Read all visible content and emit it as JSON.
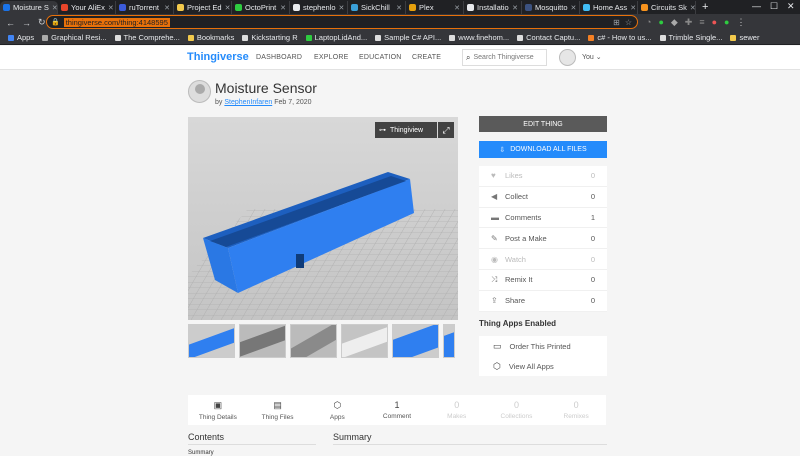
{
  "browser": {
    "tabs": [
      {
        "label": "Moisture S",
        "color": "#1a73e8",
        "active": true
      },
      {
        "label": "Your AliEx",
        "color": "#e8452a"
      },
      {
        "label": "ruTorrent",
        "color": "#3b5bdb"
      },
      {
        "label": "Project Ed",
        "color": "#f2c94c"
      },
      {
        "label": "OctoPrint",
        "color": "#2ecc40"
      },
      {
        "label": "stephenlo",
        "color": "#e8eaed"
      },
      {
        "label": "SickChill",
        "color": "#3aa0d8"
      },
      {
        "label": "Plex",
        "color": "#e5a00d"
      },
      {
        "label": "Installatio",
        "color": "#e8eaed"
      },
      {
        "label": "Mosquitto",
        "color": "#3c5280"
      },
      {
        "label": "Home Ass",
        "color": "#41bdf5"
      },
      {
        "label": "Circuits Sk",
        "color": "#f7931e"
      }
    ],
    "url": "thingiverse.com/thing:4148595",
    "bookmarks": [
      {
        "label": "Apps",
        "color": "#4285f4"
      },
      {
        "label": "Graphical Resi...",
        "color": "#aaaaaa"
      },
      {
        "label": "The Comprehe...",
        "color": "#dddddd"
      },
      {
        "label": "Bookmarks",
        "color": "#f2c94c"
      },
      {
        "label": "Kickstarting R",
        "color": "#dddddd"
      },
      {
        "label": "LaptopLidAnd...",
        "color": "#2ecc40"
      },
      {
        "label": "Sample C# API...",
        "color": "#dddddd"
      },
      {
        "label": "www.finehom...",
        "color": "#dddddd"
      },
      {
        "label": "Contact Captu...",
        "color": "#dddddd"
      },
      {
        "label": "c# - How to us...",
        "color": "#f48024"
      },
      {
        "label": "Trimble Single...",
        "color": "#dddddd"
      },
      {
        "label": "sewer",
        "color": "#f2c94c"
      }
    ]
  },
  "site": {
    "logo": "Thingiverse",
    "nav": [
      "DASHBOARD",
      "EXPLORE",
      "EDUCATION",
      "CREATE"
    ],
    "search_placeholder": "Search Thingiverse",
    "user_label": "You"
  },
  "thing": {
    "title": "Moisture Sensor",
    "by": "by",
    "author": "StephenInfaren",
    "date": "Feb 7, 2020",
    "viewer_button": "Thingiview",
    "thumbnail_count": 6
  },
  "actions": {
    "edit": "EDIT THING",
    "download": "DOWNLOAD ALL FILES"
  },
  "stats": [
    {
      "label": "Likes",
      "count": "0",
      "icon": "heart-icon",
      "glyph": "♥",
      "dim": true
    },
    {
      "label": "Collect",
      "count": "0",
      "icon": "collect-icon",
      "glyph": "◀",
      "dim": false
    },
    {
      "label": "Comments",
      "count": "1",
      "icon": "comment-icon",
      "glyph": "▬",
      "dim": false
    },
    {
      "label": "Post a Make",
      "count": "0",
      "icon": "make-icon",
      "glyph": "✎",
      "dim": false
    },
    {
      "label": "Watch",
      "count": "0",
      "icon": "watch-icon",
      "glyph": "◉",
      "dim": true
    },
    {
      "label": "Remix It",
      "count": "0",
      "icon": "remix-icon",
      "glyph": "⤨",
      "dim": false
    },
    {
      "label": "Share",
      "count": "0",
      "icon": "share-icon",
      "glyph": "⇪",
      "dim": false
    }
  ],
  "thing_apps": {
    "title": "Thing Apps Enabled",
    "items": [
      {
        "label": "Order This Printed",
        "icon": "monitor-icon",
        "glyph": "▭"
      },
      {
        "label": "View All Apps",
        "icon": "cube-icon",
        "glyph": "⬡"
      }
    ]
  },
  "detail_tabs": [
    {
      "label": "Thing Details",
      "value": "",
      "glyph": "▣",
      "icon": "details-icon",
      "dim": false
    },
    {
      "label": "Thing Files",
      "value": "",
      "glyph": "▤",
      "icon": "files-icon",
      "dim": false
    },
    {
      "label": "Apps",
      "value": "",
      "glyph": "⬡",
      "icon": "apps-icon",
      "dim": false
    },
    {
      "label": "Comment",
      "value": "1",
      "glyph": "",
      "icon": "",
      "dim": false
    },
    {
      "label": "Makes",
      "value": "0",
      "glyph": "",
      "icon": "",
      "dim": true
    },
    {
      "label": "Collections",
      "value": "0",
      "glyph": "",
      "icon": "",
      "dim": true
    },
    {
      "label": "Remixes",
      "value": "0",
      "glyph": "",
      "icon": "",
      "dim": true
    }
  ],
  "sections": {
    "contents": "Contents",
    "summary": "Summary",
    "first_item": "Summary"
  }
}
